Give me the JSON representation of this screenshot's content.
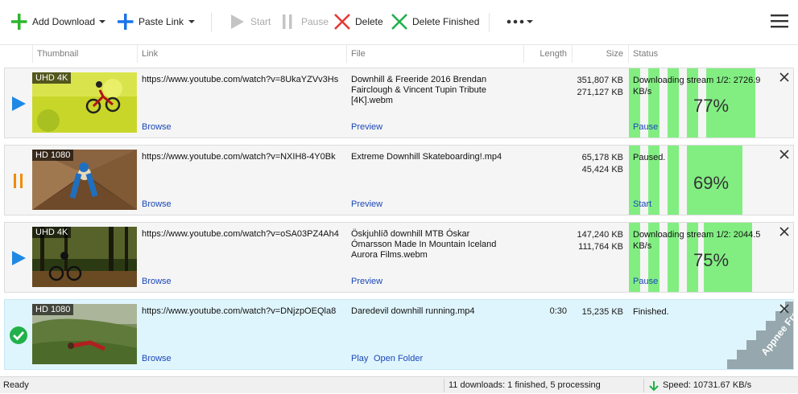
{
  "toolbar": {
    "add_download": "Add Download",
    "paste_link": "Paste Link",
    "start": "Start",
    "pause": "Pause",
    "delete": "Delete",
    "delete_finished": "Delete Finished"
  },
  "columns": {
    "thumbnail": "Thumbnail",
    "link": "Link",
    "file": "File",
    "length": "Length",
    "size": "Size",
    "status": "Status"
  },
  "rows": [
    {
      "state": "downloading",
      "quality": "UHD 4K",
      "link": "https://www.youtube.com/watch?v=8UkaYZVv3Hs",
      "browse": "Browse",
      "file": "Downhill & Freeride 2016  Brendan Fairclough & Vincent Tupin Tribute [4K].webm",
      "file_actions": [
        "Preview"
      ],
      "length": "",
      "size_total": "351,807 KB",
      "size_done": "271,127 KB",
      "status_text": "Downloading stream 1/2: 2726.9 KB/s",
      "percent": "77%",
      "progress": 0.77,
      "status_action": "Pause"
    },
    {
      "state": "paused",
      "quality": "HD 1080",
      "link": "https://www.youtube.com/watch?v=NXIH8-4Y0Bk",
      "browse": "Browse",
      "file": "Extreme Downhill Skateboarding!.mp4",
      "file_actions": [
        "Preview"
      ],
      "length": "",
      "size_total": "65,178 KB",
      "size_done": "45,424 KB",
      "status_text": "Paused.",
      "percent": "69%",
      "progress": 0.69,
      "status_action": "Start"
    },
    {
      "state": "downloading",
      "quality": "UHD 4K",
      "link": "https://www.youtube.com/watch?v=oSA03PZ4Ah4",
      "browse": "Browse",
      "file": "Öskjuhlíð downhill MTB Óskar Ómarsson Made In Mountain   Iceland Aurora Films.webm",
      "file_actions": [
        "Preview"
      ],
      "length": "",
      "size_total": "147,240 KB",
      "size_done": "111,764 KB",
      "status_text": "Downloading stream 1/2: 2044.5 KB/s",
      "percent": "75%",
      "progress": 0.75,
      "status_action": "Pause"
    },
    {
      "state": "finished",
      "quality": "HD 1080",
      "link": "https://www.youtube.com/watch?v=DNjzpOEQla8",
      "browse": "Browse",
      "file": "Daredevil downhill running.mp4",
      "file_actions": [
        "Play",
        "Open Folder"
      ],
      "length": "0:30",
      "size_total": "15,235 KB",
      "size_done": "",
      "status_text": "Finished.",
      "percent": "",
      "progress": 1,
      "status_action": ""
    }
  ],
  "watermark": "Appnee Freeware Group.",
  "statusbar": {
    "ready": "Ready",
    "summary": "11 downloads: 1 finished, 5 processing",
    "speed": "Speed: 10731.67 KB/s"
  },
  "colors": {
    "green_add": "#2db52d",
    "blue_paste": "#1a73e8",
    "progress_green": "#82ee82",
    "play_blue": "#1e88e5",
    "pause_orange": "#f08c00",
    "delete_red": "#e53935",
    "finished_green": "#21b14a",
    "row_finished_bg": "#dff5fd"
  }
}
